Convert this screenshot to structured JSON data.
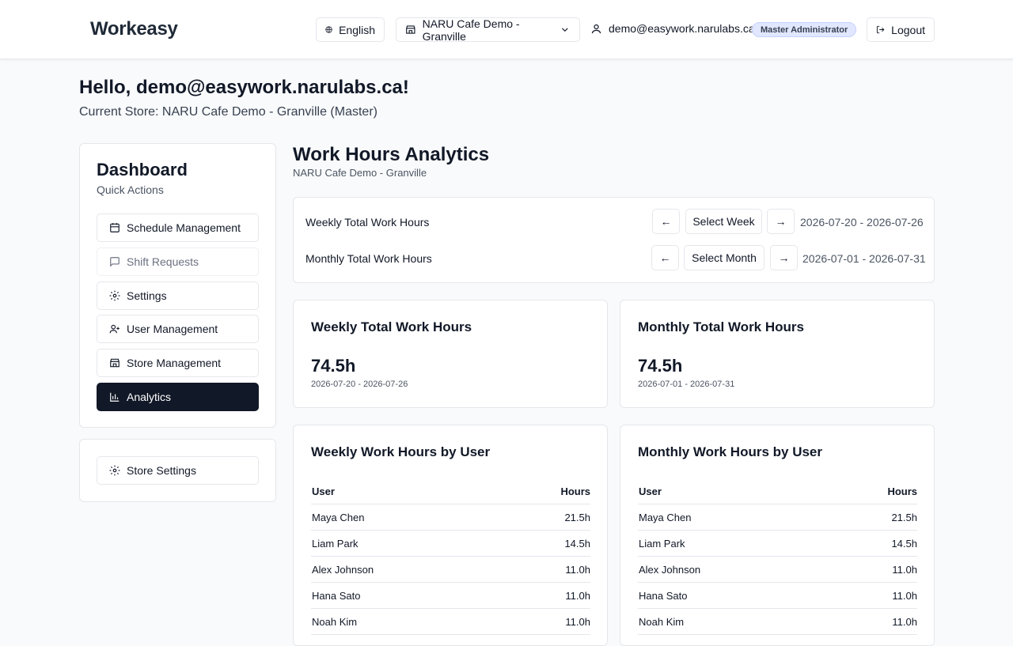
{
  "header": {
    "brand": "Workeasy",
    "language": "English",
    "store_selector": "NARU Cafe Demo - Granville",
    "user_email": "demo@easywork.narulabs.ca",
    "role": "Master Administrator",
    "logout": "Logout"
  },
  "greeting": {
    "hello": "Hello, demo@easywork.narulabs.ca!",
    "current_store": "Current Store: NARU Cafe Demo - Granville (Master)"
  },
  "sidebar": {
    "title": "Dashboard",
    "subtitle": "Quick Actions",
    "items": [
      {
        "label": "Schedule Management",
        "icon": "calendar-icon"
      },
      {
        "label": "Shift Requests",
        "icon": "message-icon"
      },
      {
        "label": "Settings",
        "icon": "gear-icon"
      },
      {
        "label": "User Management",
        "icon": "user-plus-icon"
      },
      {
        "label": "Store Management",
        "icon": "store-icon"
      },
      {
        "label": "Analytics",
        "icon": "bar-chart-icon"
      }
    ],
    "store_settings": "Store Settings"
  },
  "main": {
    "title": "Work Hours Analytics",
    "subtitle": "NARU Cafe Demo - Granville",
    "weekly_row": {
      "label": "Weekly Total Work Hours",
      "prev": "←",
      "select": "Select Week",
      "next": "→",
      "range": "2026-07-20 - 2026-07-26"
    },
    "monthly_row": {
      "label": "Monthly Total Work Hours",
      "prev": "←",
      "select": "Select Month",
      "next": "→",
      "range": "2026-07-01 - 2026-07-31"
    },
    "weekly_card": {
      "title": "Weekly Total Work Hours",
      "value": "74.5h",
      "range": "2026-07-20 - 2026-07-26"
    },
    "monthly_card": {
      "title": "Monthly Total Work Hours",
      "value": "74.5h",
      "range": "2026-07-01 - 2026-07-31"
    },
    "weekly_table": {
      "title": "Weekly Work Hours by User",
      "col_user": "User",
      "col_hours": "Hours",
      "rows": [
        {
          "user": "Maya Chen",
          "hours": "21.5h"
        },
        {
          "user": "Liam Park",
          "hours": "14.5h"
        },
        {
          "user": "Alex Johnson",
          "hours": "11.0h"
        },
        {
          "user": "Hana Sato",
          "hours": "11.0h"
        },
        {
          "user": "Noah Kim",
          "hours": "11.0h"
        }
      ]
    },
    "monthly_table": {
      "title": "Monthly Work Hours by User",
      "col_user": "User",
      "col_hours": "Hours",
      "rows": [
        {
          "user": "Maya Chen",
          "hours": "21.5h"
        },
        {
          "user": "Liam Park",
          "hours": "14.5h"
        },
        {
          "user": "Alex Johnson",
          "hours": "11.0h"
        },
        {
          "user": "Hana Sato",
          "hours": "11.0h"
        },
        {
          "user": "Noah Kim",
          "hours": "11.0h"
        }
      ]
    }
  },
  "colors": {
    "active_nav": "#111827",
    "badge_bg": "#e0e7ff",
    "background": "#f9fafb"
  }
}
